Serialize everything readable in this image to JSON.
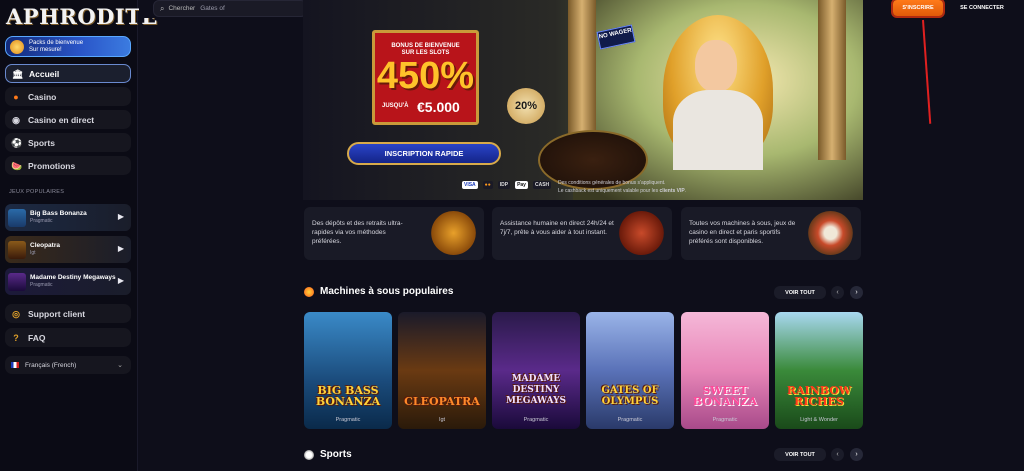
{
  "brand": {
    "logo": "APHRODITE"
  },
  "sidebar": {
    "welcome": {
      "line1": "Packs de bienvenue",
      "line2": "Sur mesure!"
    },
    "nav": [
      {
        "label": "Accueil",
        "icon": "home-icon"
      },
      {
        "label": "Casino",
        "icon": "casino-chip-icon"
      },
      {
        "label": "Casino en direct",
        "icon": "live-casino-icon"
      },
      {
        "label": "Sports",
        "icon": "soccer-ball-icon"
      },
      {
        "label": "Promotions",
        "icon": "gift-icon"
      }
    ],
    "section_label": "JEUX POPULAIRES",
    "popular": [
      {
        "name": "Big Bass Bonanza",
        "provider": "Pragmatic"
      },
      {
        "name": "Cleopatra",
        "provider": "Igt"
      },
      {
        "name": "Madame Destiny Megaways",
        "provider": "Pragmatic"
      }
    ],
    "support": {
      "label": "Support client",
      "icon": "support-icon"
    },
    "faq": {
      "label": "FAQ",
      "icon": "question-icon"
    },
    "language": {
      "label": "Français (French)"
    }
  },
  "header": {
    "search": {
      "prefix": "Chercher",
      "value": "Gates of"
    },
    "signup_label": "S'INSCRIRE",
    "login_label": "SE CONNECTER"
  },
  "hero": {
    "bonus_line1": "BONUS DE BIENVENUE",
    "bonus_line2": "SUR LES SLOTS",
    "percent": "450%",
    "upto": "JUSQU'À",
    "amount": "€5.000",
    "badge": "20%",
    "no_wager": "NO WAGER",
    "cta": "INSCRIPTION RAPIDE",
    "payments": [
      "VISA",
      "●●",
      "IDP",
      "Pay",
      "CASH"
    ],
    "terms_line1": "Des conditions générales de bonus s'appliquent.",
    "terms_line2": "Le cashback est uniquement valable pour les ",
    "terms_vip": "clients VIP",
    "terms_end": "."
  },
  "features": [
    {
      "text": "Des dépôts et des retraits ultra-rapides via vos méthodes préférées."
    },
    {
      "text": "Assistance humaine en direct 24h/24 et 7j/7, prête à vous aider à tout instant."
    },
    {
      "text": "Toutes vos machines à sous, jeux de casino en direct et paris sportifs préférés sont disponibles."
    }
  ],
  "slots": {
    "title": "Machines à sous populaires",
    "view_all": "VOIR TOUT",
    "games": [
      {
        "title": "BIG BASS BONANZA",
        "provider": "Pragmatic",
        "bg": "#2a6aa8"
      },
      {
        "title": "CLEOPATRA",
        "provider": "Igt",
        "bg": "#6a3a12"
      },
      {
        "title": "MADAME DESTINY MEGAWAYS",
        "provider": "Pragmatic",
        "bg": "#3a1a5a"
      },
      {
        "title": "GATES OF OLYMPUS",
        "provider": "Pragmatic",
        "bg": "#6a82b8"
      },
      {
        "title": "SWEET BONANZA",
        "provider": "Pragmatic",
        "bg": "#e886b8"
      },
      {
        "title": "RAINBOW RICHES",
        "provider": "Light & Wonder",
        "bg": "#3a8a3a"
      }
    ]
  },
  "sports": {
    "title": "Sports",
    "view_all": "VOIR TOUT"
  },
  "colors": {
    "accent_orange": "#ff7a1a",
    "nav_active_border": "#6a8ad0",
    "hero_red": "#b8141a",
    "gold": "#ffc22a"
  }
}
